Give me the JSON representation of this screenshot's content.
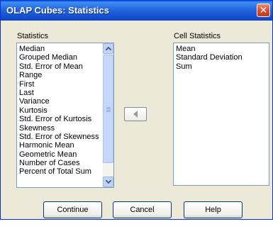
{
  "window": {
    "title": "OLAP Cubes: Statistics",
    "close_glyph": "✕"
  },
  "statistics": {
    "label": "Statistics",
    "items": [
      "Median",
      "Grouped Median",
      "Std. Error of Mean",
      "Range",
      "First",
      "Last",
      "Variance",
      "Kurtosis",
      "Std. Error of Kurtosis",
      "Skewness",
      "Std. Error of Skewness",
      "Harmonic Mean",
      "Geometric Mean",
      "Number of Cases",
      "Percent of Total Sum"
    ]
  },
  "cell_statistics": {
    "label": "Cell Statistics",
    "items": [
      "Mean",
      "Standard Deviation",
      "Sum"
    ]
  },
  "move_button": {
    "icon": "triangle-left-icon"
  },
  "buttons": {
    "continue": "Continue",
    "cancel": "Cancel",
    "help": "Help"
  },
  "colors": {
    "title_bar": "#2466de",
    "dialog_bg": "#ece9d8",
    "close_button": "#d6452a"
  }
}
